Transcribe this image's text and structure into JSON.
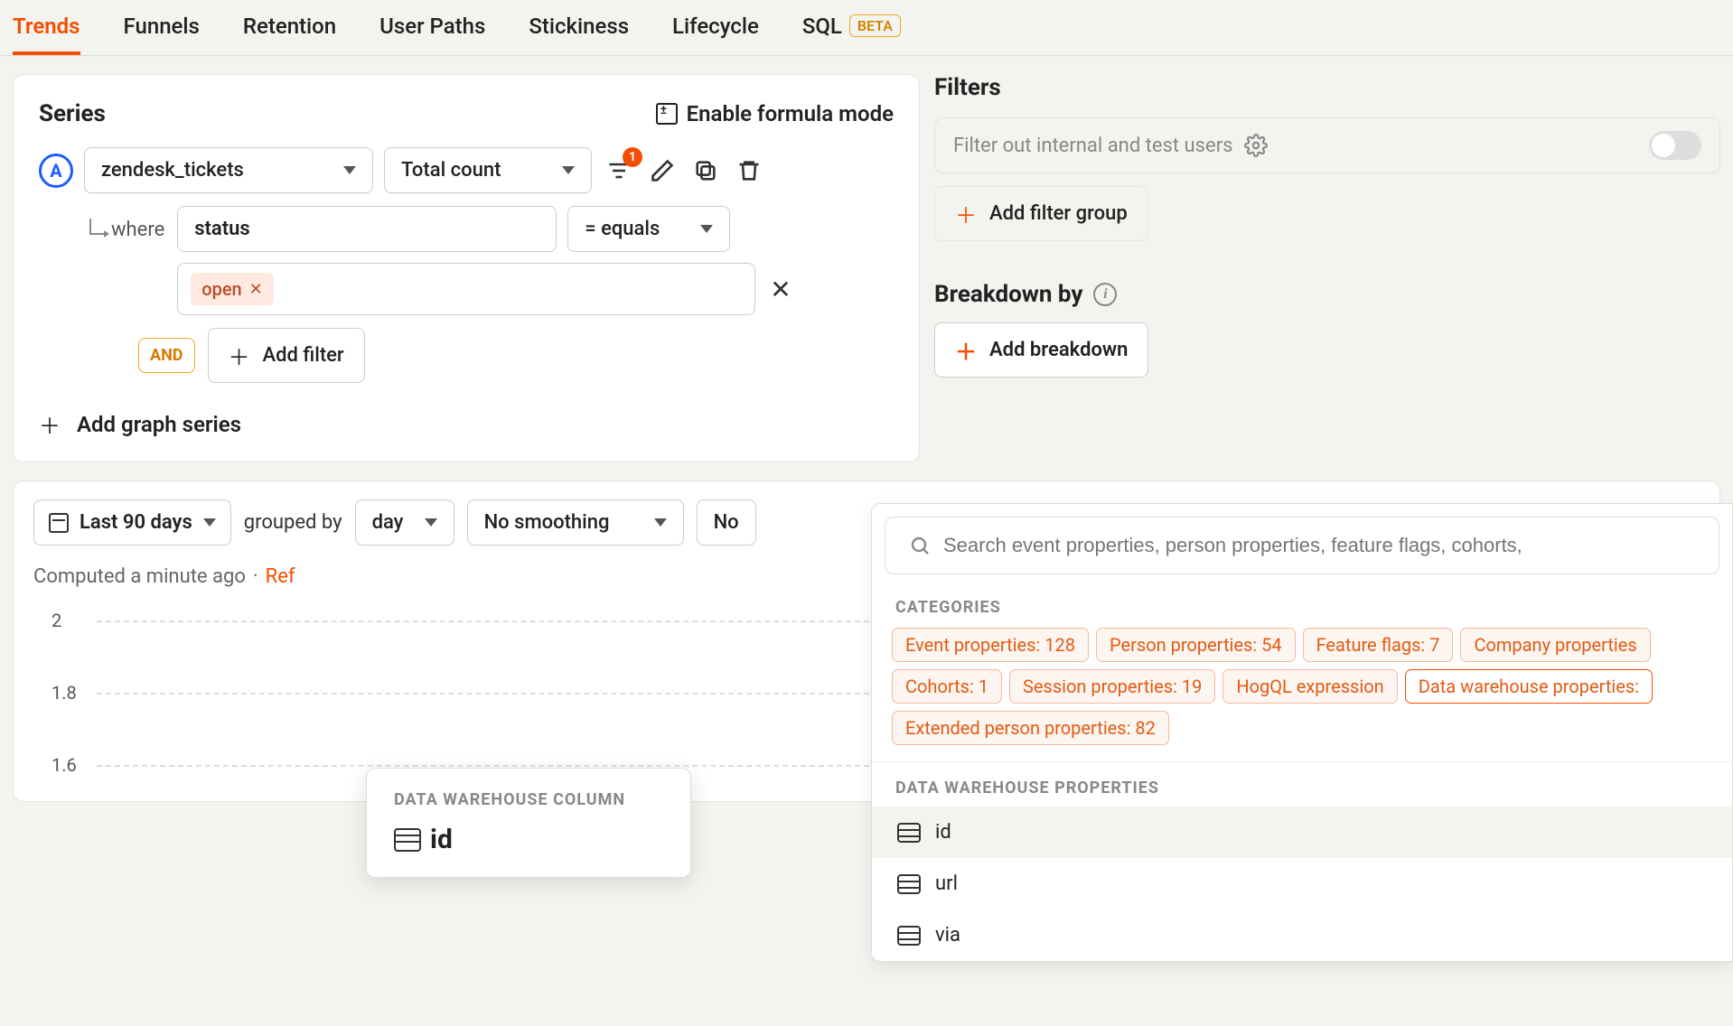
{
  "tabs": [
    {
      "label": "Trends",
      "active": true
    },
    {
      "label": "Funnels"
    },
    {
      "label": "Retention"
    },
    {
      "label": "User Paths"
    },
    {
      "label": "Stickiness"
    },
    {
      "label": "Lifecycle"
    },
    {
      "label": "SQL",
      "beta": "BETA"
    }
  ],
  "series": {
    "title": "Series",
    "formula_toggle": "Enable formula mode",
    "badge": "A",
    "event": "zendesk_tickets",
    "agg": "Total count",
    "filter_count": "1",
    "where_label": "where",
    "property": "status",
    "operator": "= equals",
    "value": "open",
    "and_label": "AND",
    "add_filter": "Add filter",
    "add_series": "Add graph series"
  },
  "filters": {
    "title": "Filters",
    "exclude_placeholder": "Filter out internal and test users",
    "add_group": "Add filter group"
  },
  "breakdown": {
    "title": "Breakdown by",
    "add": "Add breakdown"
  },
  "popover": {
    "search_placeholder": "Search event properties, person properties, feature flags, cohorts,",
    "categories_header": "CATEGORIES",
    "categories": [
      {
        "label": "Event properties: 128"
      },
      {
        "label": "Person properties: 54"
      },
      {
        "label": "Feature flags: 7"
      },
      {
        "label": "Company properties"
      },
      {
        "label": "Cohorts: 1"
      },
      {
        "label": "Session properties: 19"
      },
      {
        "label": "HogQL expression"
      },
      {
        "label": "Data warehouse properties:",
        "active": true
      },
      {
        "label": "Extended person properties: 82"
      }
    ],
    "section_header": "DATA WAREHOUSE PROPERTIES",
    "items": [
      "id",
      "url",
      "via"
    ]
  },
  "controls": {
    "date_range": "Last 90 days",
    "grouped_by_label": "grouped by",
    "interval": "day",
    "smoothing": "No smoothing",
    "compare": "No"
  },
  "computed": {
    "text": "Computed a minute ago",
    "sep": "·",
    "ref": "Ref"
  },
  "tooltip": {
    "header": "DATA WAREHOUSE COLUMN",
    "value": "id"
  },
  "chart_data": {
    "type": "line",
    "ylim": [
      1.6,
      2.0
    ],
    "y_ticks": [
      2,
      1.8,
      1.6
    ]
  }
}
